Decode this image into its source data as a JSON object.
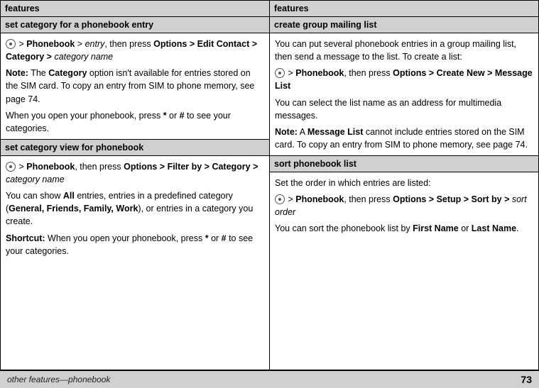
{
  "columns": [
    {
      "header": "features",
      "sections": [
        {
          "type": "subheader",
          "title": "set category for a phonebook entry"
        },
        {
          "type": "content",
          "paragraphs": [
            {
              "parts": [
                {
                  "text": "• > ",
                  "style": "normal"
                },
                {
                  "text": "Phonebook",
                  "style": "bold"
                },
                {
                  "text": " > ",
                  "style": "normal"
                },
                {
                  "text": "entry",
                  "style": "italic"
                },
                {
                  "text": ", then press",
                  "style": "normal"
                },
                {
                  "text": " Options > Edit Contact > Category > ",
                  "style": "bold"
                },
                {
                  "text": "category name",
                  "style": "italic"
                }
              ]
            },
            {
              "parts": [
                {
                  "text": "Note:",
                  "style": "bold"
                },
                {
                  "text": " The ",
                  "style": "normal"
                },
                {
                  "text": "Category",
                  "style": "bold"
                },
                {
                  "text": " option isn't available for entries stored on the SIM card. To copy an entry from SIM to phone memory, see page 74.",
                  "style": "normal"
                }
              ]
            },
            {
              "parts": [
                {
                  "text": "When you open your phonebook, press * or # to see your categories.",
                  "style": "normal"
                }
              ]
            }
          ]
        },
        {
          "type": "subheader",
          "title": "set category view for phonebook"
        },
        {
          "type": "content",
          "paragraphs": [
            {
              "parts": [
                {
                  "text": "• > ",
                  "style": "normal"
                },
                {
                  "text": "Phonebook",
                  "style": "bold"
                },
                {
                  "text": ", then press ",
                  "style": "normal"
                },
                {
                  "text": "Options > Filter by > Category > ",
                  "style": "bold"
                },
                {
                  "text": "category name",
                  "style": "italic"
                }
              ]
            },
            {
              "parts": [
                {
                  "text": "You can show ",
                  "style": "normal"
                },
                {
                  "text": "All",
                  "style": "bold"
                },
                {
                  "text": " entries, entries in a predefined category (",
                  "style": "normal"
                },
                {
                  "text": "General, Friends, Family, Work",
                  "style": "bold"
                },
                {
                  "text": "), or entries in a category you create.",
                  "style": "normal"
                }
              ]
            },
            {
              "parts": [
                {
                  "text": "Shortcut:",
                  "style": "bold"
                },
                {
                  "text": " When you open your phonebook, press * or # to see your categories.",
                  "style": "normal"
                }
              ]
            }
          ]
        }
      ]
    },
    {
      "header": "features",
      "sections": [
        {
          "type": "subheader",
          "title": "create group mailing list"
        },
        {
          "type": "content",
          "paragraphs": [
            {
              "parts": [
                {
                  "text": "You can put several phonebook entries in a group mailing list, then send a message to the list. To create a list:",
                  "style": "normal"
                }
              ]
            },
            {
              "parts": [
                {
                  "text": "• > ",
                  "style": "normal"
                },
                {
                  "text": "Phonebook",
                  "style": "bold"
                },
                {
                  "text": ", then press",
                  "style": "normal"
                },
                {
                  "text": " Options > Create New > Message List",
                  "style": "bold"
                }
              ]
            },
            {
              "parts": [
                {
                  "text": "You can select the list name as an address for multimedia messages.",
                  "style": "normal"
                }
              ]
            },
            {
              "parts": [
                {
                  "text": "Note:",
                  "style": "bold"
                },
                {
                  "text": " A ",
                  "style": "normal"
                },
                {
                  "text": "Message List",
                  "style": "bold"
                },
                {
                  "text": " cannot include entries stored on the SIM card. To copy an entry from SIM to phone memory, see page 74.",
                  "style": "normal"
                }
              ]
            }
          ]
        },
        {
          "type": "subheader",
          "title": "sort phonebook list"
        },
        {
          "type": "content",
          "paragraphs": [
            {
              "parts": [
                {
                  "text": "Set the order in which entries are listed:",
                  "style": "normal"
                }
              ]
            },
            {
              "parts": [
                {
                  "text": "• > ",
                  "style": "normal"
                },
                {
                  "text": "Phonebook",
                  "style": "bold"
                },
                {
                  "text": ", then press",
                  "style": "normal"
                },
                {
                  "text": " Options > Setup > Sort by > ",
                  "style": "bold"
                },
                {
                  "text": "sort order",
                  "style": "italic"
                }
              ]
            },
            {
              "parts": [
                {
                  "text": "You can sort the phonebook list by ",
                  "style": "normal"
                },
                {
                  "text": "First Name",
                  "style": "bold"
                },
                {
                  "text": " or ",
                  "style": "normal"
                },
                {
                  "text": "Last Name",
                  "style": "bold"
                },
                {
                  "text": ".",
                  "style": "normal"
                }
              ]
            }
          ]
        }
      ]
    }
  ],
  "footer": {
    "left": "other features—phonebook",
    "right": "73"
  }
}
